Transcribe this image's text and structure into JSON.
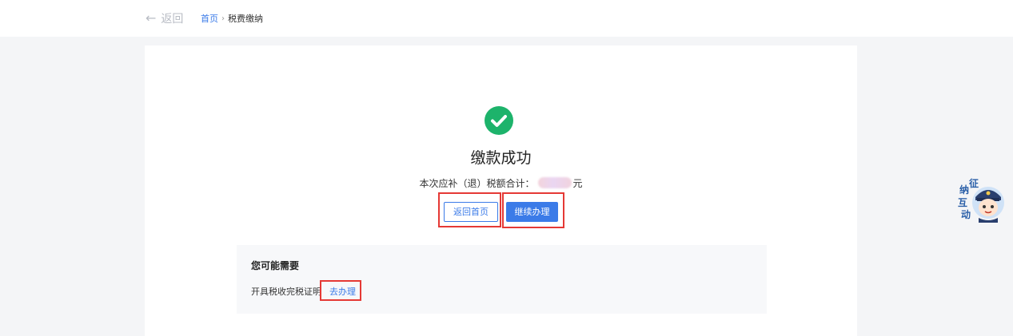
{
  "header": {
    "back_label": "返回",
    "breadcrumb": {
      "home": "首页",
      "separator": "›",
      "current": "税费缴纳"
    }
  },
  "result": {
    "status": "success",
    "title": "缴款成功",
    "summary_prefix": "本次应补（退）税额合计：",
    "summary_unit": "元"
  },
  "actions": {
    "home_label": "返回首页",
    "continue_label": "继续办理"
  },
  "suggestions": {
    "title": "您可能需要",
    "items": [
      {
        "label": "开具税收完税证明",
        "link": "去办理"
      }
    ]
  },
  "assistant": {
    "label_chars": [
      "纳",
      "征",
      "互",
      "动"
    ]
  },
  "colors": {
    "primary": "#3b7be8",
    "success": "#1db36b",
    "highlight": "#e53935"
  }
}
